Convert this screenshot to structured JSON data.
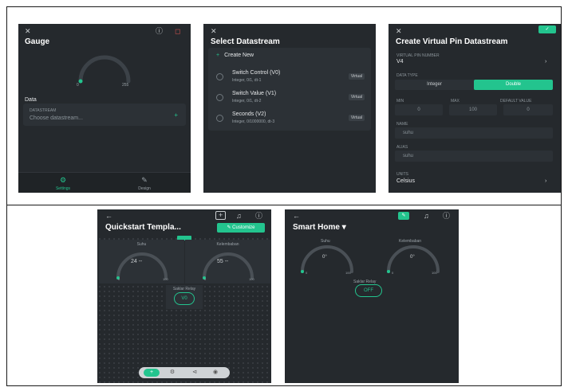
{
  "colors": {
    "accent": "#23c48e",
    "screen_bg": "#25292d",
    "panel_bg": "#2c3136"
  },
  "screen1": {
    "title": "Gauge",
    "gauge_min": "0",
    "gauge_max": "255",
    "data_label": "Data",
    "datastream_label": "DATASTREAM",
    "datastream_placeholder": "Choose datastream...",
    "tabs": [
      {
        "label": "Settings",
        "icon": "settings-icon"
      },
      {
        "label": "Design",
        "icon": "design-icon"
      }
    ]
  },
  "screen2": {
    "title": "Select Datastream",
    "create_label": "Create New",
    "rows": [
      {
        "name": "Switch Control (V0)",
        "sub": "Integer, 0/1, dt-1",
        "badge": "Virtual"
      },
      {
        "name": "Switch Value (V1)",
        "sub": "Integer, 0/1, dt-2",
        "badge": "Virtual"
      },
      {
        "name": "Seconds (V2)",
        "sub": "Integer, 0/1000000, dt-3",
        "badge": "Virtual"
      }
    ]
  },
  "screen3": {
    "title": "Create Virtual Pin Datastream",
    "pin_label": "VIRTUAL PIN NUMBER",
    "pin_value": "V4",
    "datatype_label": "DATA TYPE",
    "datatype_options": [
      "Integer",
      "Double"
    ],
    "min_label": "MIN",
    "max_label": "MAX",
    "default_label": "DEFAULT VALUE",
    "min_value": "0",
    "max_value": "100",
    "default_value": "0",
    "name_label": "NAME",
    "name_value": "suhu",
    "alias_label": "ALIAS",
    "alias_value": "suhu",
    "units_label": "UNITS",
    "units_value": "Celsius"
  },
  "screen4": {
    "title": "Quickstart Templa...",
    "customize_label": "Customize",
    "gauge1_label": "Suhu",
    "gauge2_label": "Kelembaban",
    "gauge1_value": "24 --",
    "gauge2_value": "55 --",
    "gauge_min": "0",
    "gauge_max": "100",
    "button_widget_label": "Saklar Relay",
    "button_value": "V0"
  },
  "screen5": {
    "title": "Smart Home",
    "gauge1_label": "Suhu",
    "gauge2_label": "Kelembaban",
    "gauge1_value": "0°",
    "gauge2_value": "0°",
    "gauge_min": "0",
    "gauge1_max": "100",
    "gauge2_max": "100",
    "relay_label": "Saklar Relay",
    "relay_value": "OFF"
  }
}
